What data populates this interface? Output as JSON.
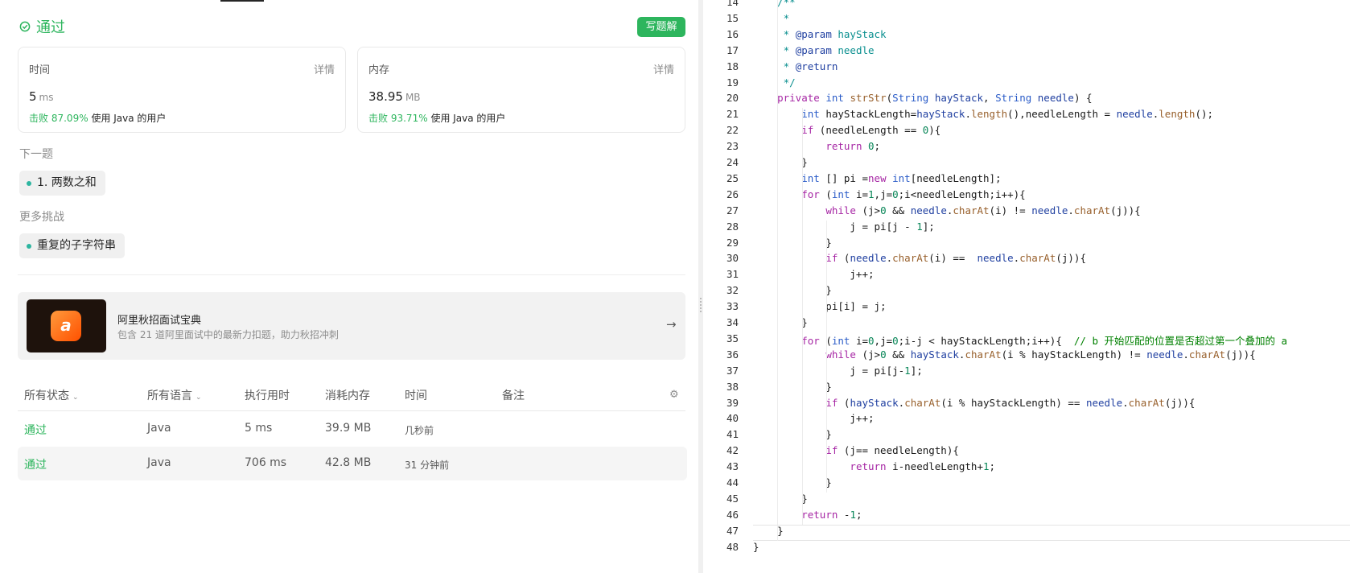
{
  "left": {
    "status_label": "通过",
    "solution_button": "写题解",
    "runtime_card": {
      "label": "时间",
      "detail": "详情",
      "value": "5",
      "unit": "ms",
      "beat_prefix": "击败",
      "beat_percent": "87.09%",
      "beat_suffix": "使用 Java 的用户"
    },
    "memory_card": {
      "label": "内存",
      "detail": "详情",
      "value": "38.95",
      "unit": "MB",
      "beat_prefix": "击败",
      "beat_percent": "93.71%",
      "beat_suffix": "使用 Java 的用户"
    },
    "next_section": "下一题",
    "next_problem": "1. 两数之和",
    "more_section": "更多挑战",
    "more_problem": "重复的子字符串",
    "banner": {
      "title": "阿里秋招面试宝典",
      "desc": "包含 21 道阿里面试中的最新力扣题，助力秋招冲刺",
      "logo_glyph": "a"
    },
    "table": {
      "headers": [
        "所有状态",
        "所有语言",
        "执行用时",
        "消耗内存",
        "时间",
        "备注"
      ],
      "rows": [
        {
          "status": "通过",
          "lang": "Java",
          "runtime": "5 ms",
          "memory": "39.9 MB",
          "time": "几秒前"
        },
        {
          "status": "通过",
          "lang": "Java",
          "runtime": "706 ms",
          "memory": "42.8 MB",
          "time": "31 分钟前"
        }
      ]
    }
  },
  "code": {
    "current_line": 47,
    "lines": [
      {
        "no": 14,
        "text": "    /**"
      },
      {
        "no": 15,
        "text": "     *"
      },
      {
        "no": 16,
        "text": "     * @param hayStack"
      },
      {
        "no": 17,
        "text": "     * @param needle"
      },
      {
        "no": 18,
        "text": "     * @return"
      },
      {
        "no": 19,
        "text": "     */"
      },
      {
        "no": 20,
        "text": "    private int strStr(String hayStack, String needle) {"
      },
      {
        "no": 21,
        "text": "        int hayStackLength=hayStack.length(),needleLength = needle.length();"
      },
      {
        "no": 22,
        "text": "        if (needleLength == 0){"
      },
      {
        "no": 23,
        "text": "            return 0;"
      },
      {
        "no": 24,
        "text": "        }"
      },
      {
        "no": 25,
        "text": "        int [] pi =new int[needleLength];"
      },
      {
        "no": 26,
        "text": "        for (int i=1,j=0;i<needleLength;i++){"
      },
      {
        "no": 27,
        "text": "            while (j>0 && needle.charAt(i) != needle.charAt(j)){"
      },
      {
        "no": 28,
        "text": "                j = pi[j - 1];"
      },
      {
        "no": 29,
        "text": "            }"
      },
      {
        "no": 30,
        "text": "            if (needle.charAt(i) ==  needle.charAt(j)){"
      },
      {
        "no": 31,
        "text": "                j++;"
      },
      {
        "no": 32,
        "text": "            }"
      },
      {
        "no": 33,
        "text": "            pi[i] = j;"
      },
      {
        "no": 34,
        "text": "        }"
      },
      {
        "no": 35,
        "text": "        for (int i=0,j=0;i-j < hayStackLength;i++){  // b 开始匹配的位置是否超过第一个叠加的 a"
      },
      {
        "no": 36,
        "text": "            while (j>0 && hayStack.charAt(i % hayStackLength) != needle.charAt(j)){"
      },
      {
        "no": 37,
        "text": "                j = pi[j-1];"
      },
      {
        "no": 38,
        "text": "            }"
      },
      {
        "no": 39,
        "text": "            if (hayStack.charAt(i % hayStackLength) == needle.charAt(j)){"
      },
      {
        "no": 40,
        "text": "                j++;"
      },
      {
        "no": 41,
        "text": "            }"
      },
      {
        "no": 42,
        "text": "            if (j== needleLength){"
      },
      {
        "no": 43,
        "text": "                return i-needleLength+1;"
      },
      {
        "no": 44,
        "text": "            }"
      },
      {
        "no": 45,
        "text": "        }"
      },
      {
        "no": 46,
        "text": "        return -1;"
      },
      {
        "no": 47,
        "text": "    }"
      },
      {
        "no": 48,
        "text": "}"
      }
    ]
  },
  "colors": {
    "accent_green": "#2db55d",
    "keyword": "#a626a4",
    "type": "#2b5cc8",
    "comment": "#008000"
  }
}
